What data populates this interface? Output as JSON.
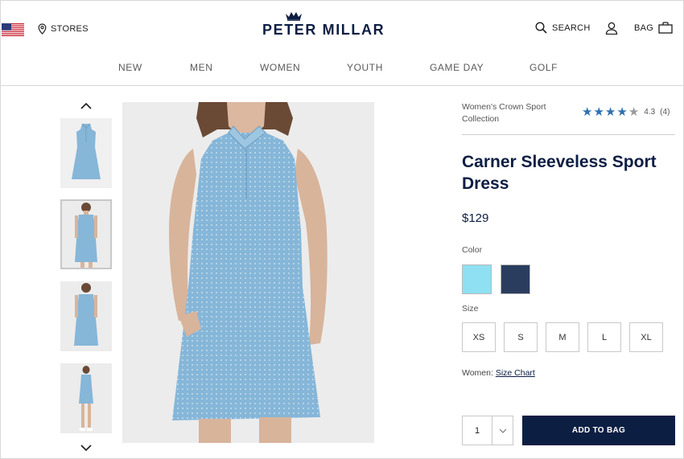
{
  "header": {
    "stores_label": "STORES",
    "logo_text": "PETER MILLAR",
    "search_label": "SEARCH",
    "bag_label": "BAG"
  },
  "nav": {
    "items": [
      "NEW",
      "MEN",
      "WOMEN",
      "YOUTH",
      "GAME DAY",
      "GOLF"
    ]
  },
  "product": {
    "collection": "Women's Crown Sport Collection",
    "rating": {
      "stars": 4.3,
      "value": "4.3",
      "count": "(4)"
    },
    "title": "Carner Sleeveless Sport Dress",
    "price": "$129",
    "color_label": "Color",
    "colors": [
      "#8fe0f2",
      "#2b3d5e"
    ],
    "size_label": "Size",
    "sizes": [
      "XS",
      "S",
      "M",
      "L",
      "XL"
    ],
    "size_chart_prefix": "Women:",
    "size_chart_link": "Size Chart",
    "quantity": "1",
    "add_to_bag": "ADD TO BAG"
  },
  "colors": {
    "brand_navy": "#0d1e43",
    "star_blue": "#2f6fb0",
    "dress_blue": "#86b6d8"
  }
}
